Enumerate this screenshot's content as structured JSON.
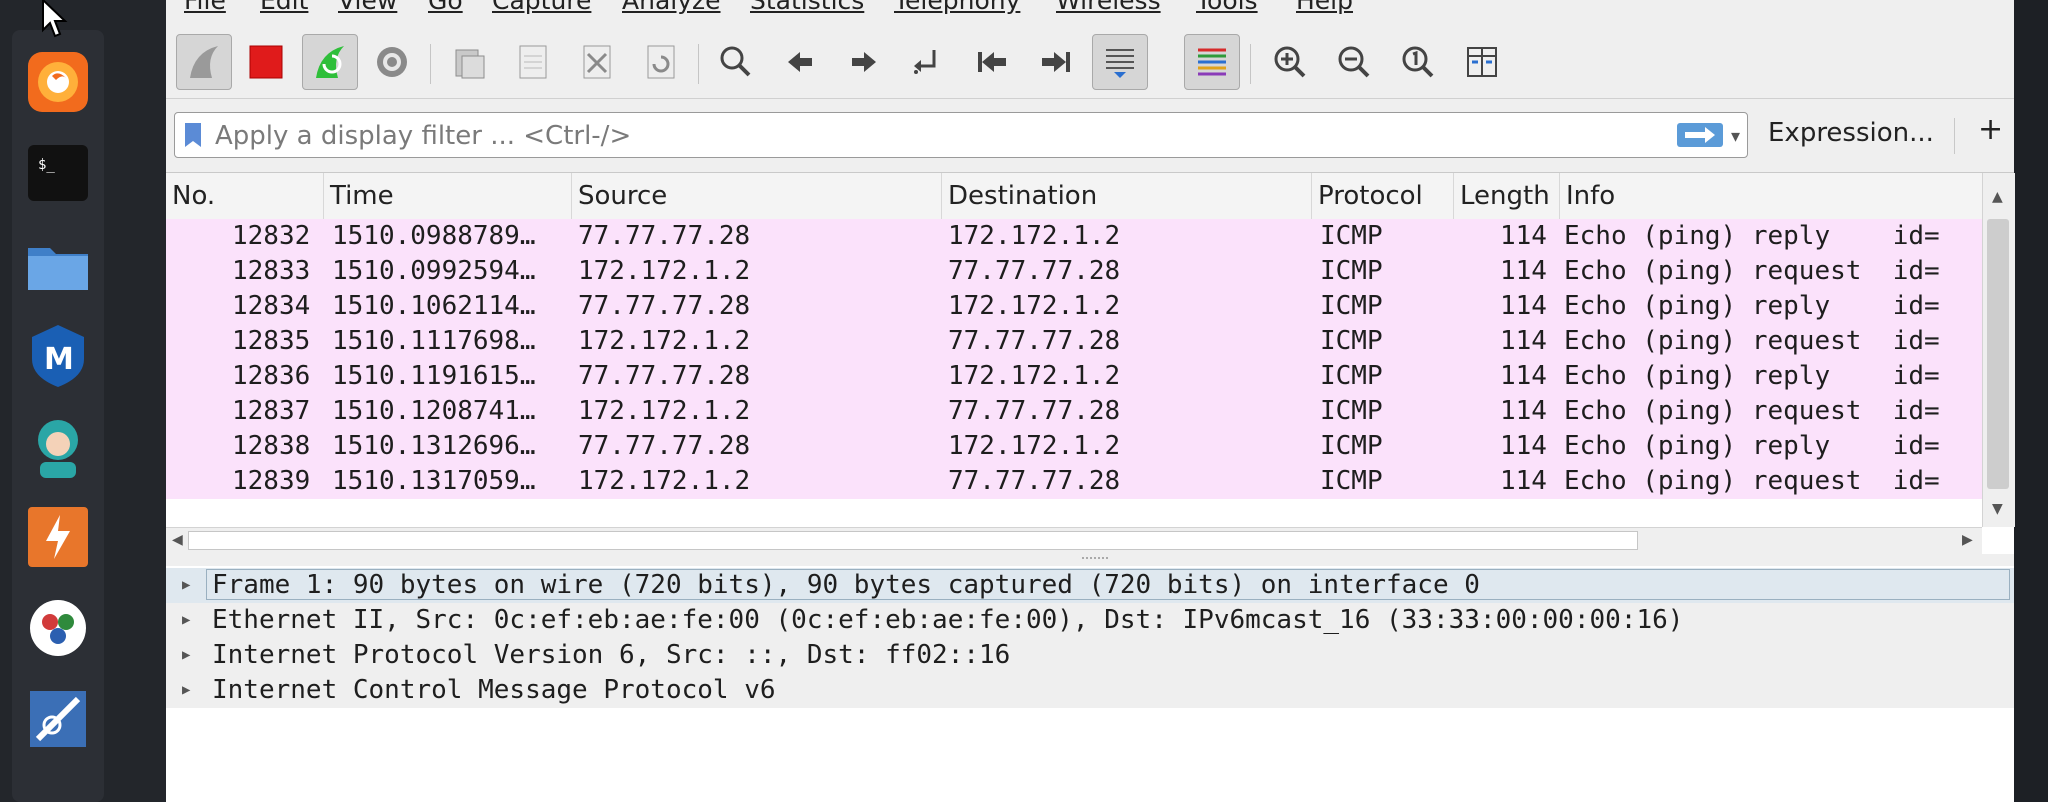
{
  "dock": {
    "items": [
      {
        "name": "firefox-icon",
        "color": "#f26b1d"
      },
      {
        "name": "terminal-icon",
        "color": "#111111"
      },
      {
        "name": "files-icon",
        "color": "#4a90d9"
      },
      {
        "name": "metasploit-icon",
        "color": "#1a5fb4"
      },
      {
        "name": "anime-avatar-icon",
        "color": "#2aa6a6"
      },
      {
        "name": "burpsuite-icon",
        "color": "#e8762b"
      },
      {
        "name": "maltego-icon",
        "color": "#ffffff"
      },
      {
        "name": "armitage-icon",
        "color": "#3b6fb6"
      }
    ]
  },
  "menubar": {
    "items": [
      "File",
      "Edit",
      "View",
      "Go",
      "Capture",
      "Analyze",
      "Statistics",
      "Telephony",
      "Wireless",
      "Tools",
      "Help"
    ]
  },
  "toolbar": {
    "icons": [
      "shark-fin-start-icon",
      "stop-capture-icon",
      "restart-capture-icon",
      "capture-options-icon",
      "open-file-icon",
      "save-file-icon",
      "close-file-icon",
      "reload-file-icon",
      "find-packet-icon",
      "go-back-icon",
      "go-forward-icon",
      "go-to-packet-icon",
      "first-packet-icon",
      "last-packet-icon",
      "auto-scroll-icon",
      "colorize-icon",
      "zoom-in-icon",
      "zoom-out-icon",
      "normal-size-icon",
      "resize-columns-icon"
    ]
  },
  "filter": {
    "placeholder": "Apply a display filter ... <Ctrl-/>",
    "value": "",
    "expression_label": "Expression...",
    "plus_label": "+"
  },
  "packet_list": {
    "columns": [
      "No.",
      "Time",
      "Source",
      "Destination",
      "Protocol",
      "Length",
      "Info"
    ],
    "rows": [
      {
        "no": "12832",
        "time": "1510.0988789…",
        "source": "77.77.77.28",
        "destination": "172.172.1.2",
        "protocol": "ICMP",
        "length": "114",
        "info": "Echo (ping) reply    id="
      },
      {
        "no": "12833",
        "time": "1510.0992594…",
        "source": "172.172.1.2",
        "destination": "77.77.77.28",
        "protocol": "ICMP",
        "length": "114",
        "info": "Echo (ping) request  id="
      },
      {
        "no": "12834",
        "time": "1510.1062114…",
        "source": "77.77.77.28",
        "destination": "172.172.1.2",
        "protocol": "ICMP",
        "length": "114",
        "info": "Echo (ping) reply    id="
      },
      {
        "no": "12835",
        "time": "1510.1117698…",
        "source": "172.172.1.2",
        "destination": "77.77.77.28",
        "protocol": "ICMP",
        "length": "114",
        "info": "Echo (ping) request  id="
      },
      {
        "no": "12836",
        "time": "1510.1191615…",
        "source": "77.77.77.28",
        "destination": "172.172.1.2",
        "protocol": "ICMP",
        "length": "114",
        "info": "Echo (ping) reply    id="
      },
      {
        "no": "12837",
        "time": "1510.1208741…",
        "source": "172.172.1.2",
        "destination": "77.77.77.28",
        "protocol": "ICMP",
        "length": "114",
        "info": "Echo (ping) request  id="
      },
      {
        "no": "12838",
        "time": "1510.1312696…",
        "source": "77.77.77.28",
        "destination": "172.172.1.2",
        "protocol": "ICMP",
        "length": "114",
        "info": "Echo (ping) reply    id="
      },
      {
        "no": "12839",
        "time": "1510.1317059…",
        "source": "172.172.1.2",
        "destination": "77.77.77.28",
        "protocol": "ICMP",
        "length": "114",
        "info": "Echo (ping) request  id="
      }
    ],
    "row_color": "#fbe2fb"
  },
  "packet_details": {
    "rows": [
      "Frame 1: 90 bytes on wire (720 bits), 90 bytes captured (720 bits) on interface 0",
      "Ethernet II, Src: 0c:ef:eb:ae:fe:00 (0c:ef:eb:ae:fe:00), Dst: IPv6mcast_16 (33:33:00:00:00:16)",
      "Internet Protocol Version 6, Src: ::, Dst: ff02::16",
      "Internet Control Message Protocol v6"
    ]
  }
}
